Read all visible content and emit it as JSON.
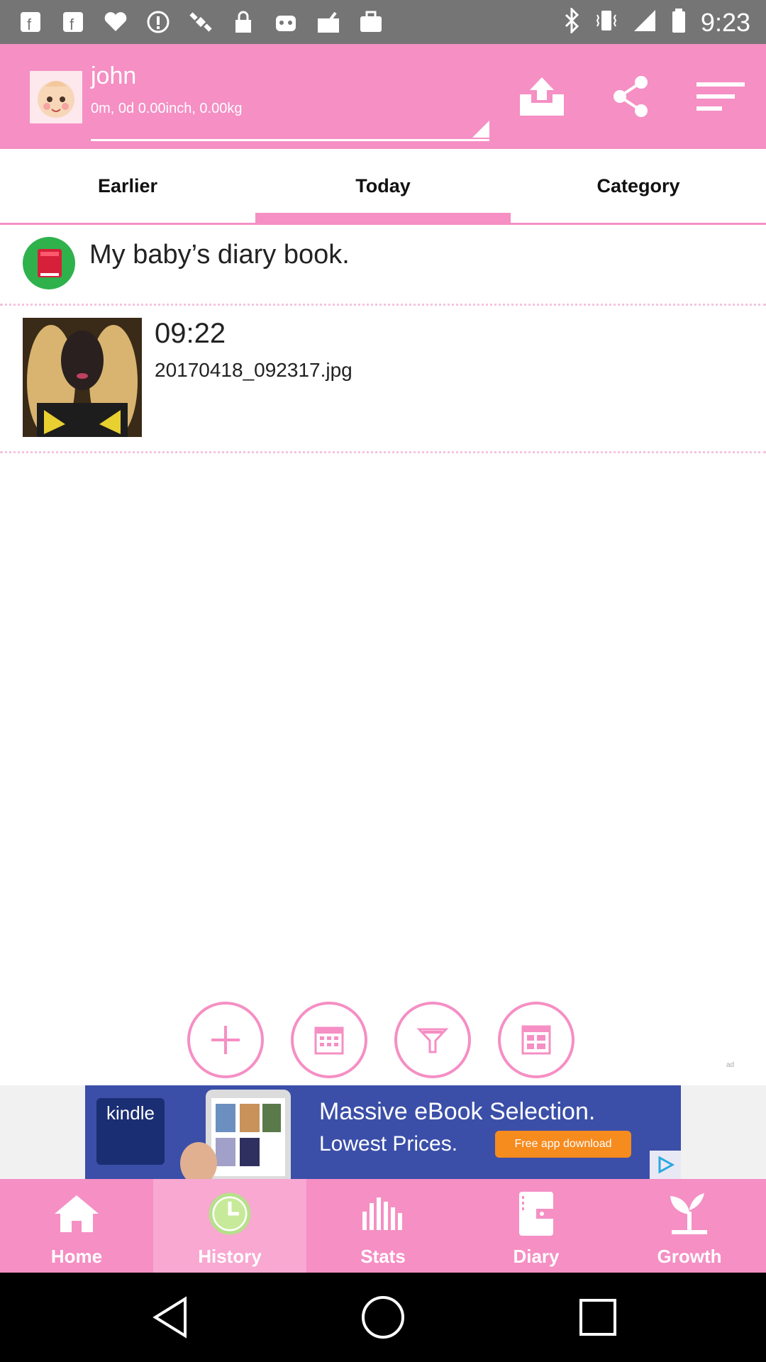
{
  "status_bar": {
    "time": "9:23",
    "icons": [
      "facebook-icon",
      "facebook-icon",
      "iheart-icon",
      "alert-icon",
      "satellite-icon",
      "lock-icon",
      "android-icon",
      "checkbox-icon",
      "bag-icon"
    ]
  },
  "header": {
    "name": "john",
    "stats": "0m, 0d 0.00inch, 0.00kg"
  },
  "tabs": [
    {
      "label": "Earlier"
    },
    {
      "label": "Today"
    },
    {
      "label": "Category"
    }
  ],
  "entries": [
    {
      "title": "My baby’s diary book."
    },
    {
      "time": "09:22",
      "filename": "20170418_092317.jpg"
    }
  ],
  "ad": {
    "brand": "kindle",
    "line1": "Massive eBook Selection.",
    "line2": "Lowest Prices.",
    "button": "Free app download",
    "tiny": "ad"
  },
  "bottom_nav": [
    {
      "label": "Home"
    },
    {
      "label": "History"
    },
    {
      "label": "Stats"
    },
    {
      "label": "Diary"
    },
    {
      "label": "Growth"
    }
  ],
  "colors": {
    "accent": "#f58fc4",
    "ad_bg": "#3b4fa8",
    "ad_button": "#f68b1e"
  }
}
